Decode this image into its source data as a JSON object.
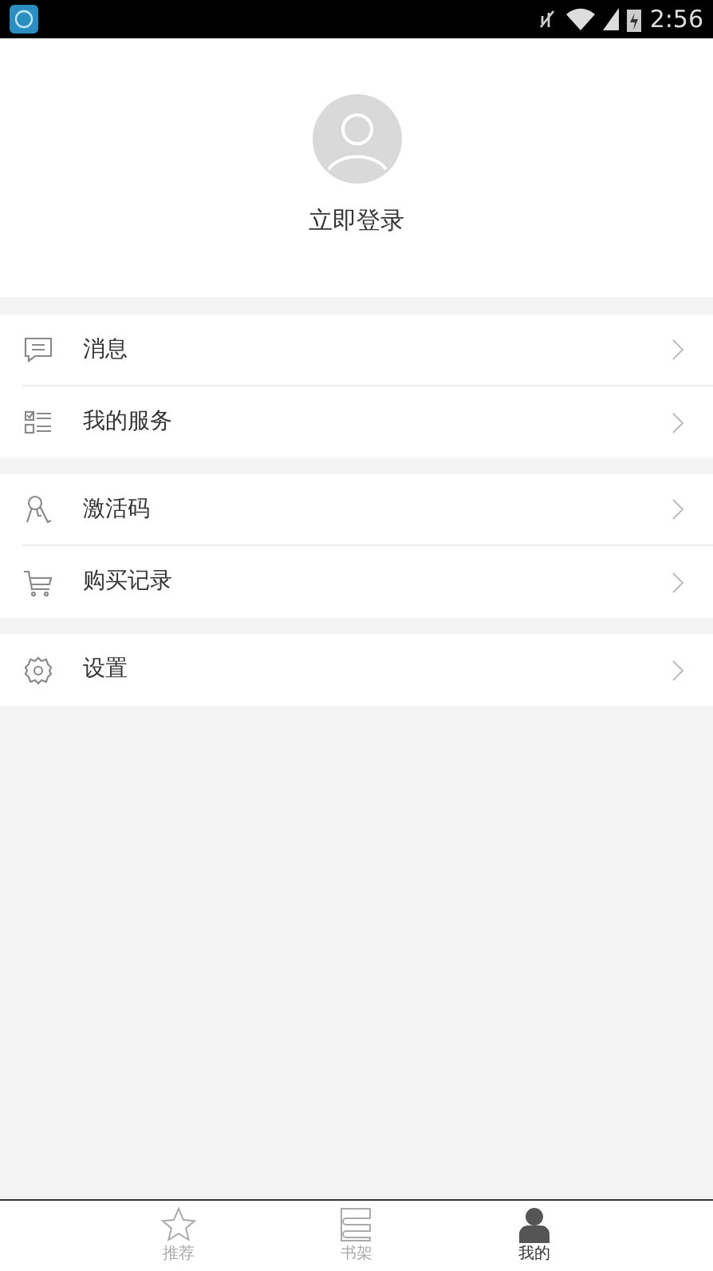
{
  "status_bar": {
    "time": "2:56"
  },
  "profile": {
    "login_label": "立即登录"
  },
  "menu_groups": [
    {
      "items": [
        {
          "kind": "message",
          "label": "消息"
        },
        {
          "kind": "services",
          "label": "我的服务"
        }
      ]
    },
    {
      "items": [
        {
          "kind": "keys",
          "label": "激活码"
        },
        {
          "kind": "cart",
          "label": "购买记录"
        }
      ]
    },
    {
      "items": [
        {
          "kind": "settings",
          "label": "设置"
        }
      ]
    }
  ],
  "tabs": [
    {
      "kind": "star",
      "label": "推荐",
      "selected": false
    },
    {
      "kind": "shelf",
      "label": "书架",
      "selected": false
    },
    {
      "kind": "person",
      "label": "我的",
      "selected": true
    }
  ]
}
